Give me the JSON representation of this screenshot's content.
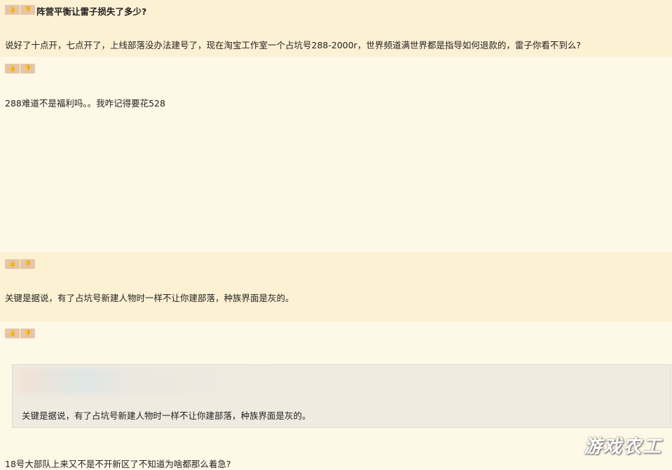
{
  "thread": {
    "title": "阵营平衡让雷子损失了多少?"
  },
  "vote": {
    "up_icon": "👍",
    "down_icon": "👎"
  },
  "posts": [
    {
      "content": "说好了十点开，七点开了，上线部落没办法建号了，现在淘宝工作室一个占坑号288-2000r，世界频道满世界都是指导如何退款的，雷子你看不到么?"
    },
    {
      "content": "288难道不是福利吗。。我咋记得要花528"
    },
    {
      "content": "关键是据说，有了占坑号新建人物时一样不让你建部落，种族界面是灰的。"
    },
    {
      "quote": {
        "content": "关键是据说，有了占坑号新建人物时一样不让你建部落，种族界面是灰的。"
      },
      "content": "18号大部队上来又不是不开新区了不知道为啥都那么着急?"
    }
  ],
  "watermark": "游戏农工"
}
